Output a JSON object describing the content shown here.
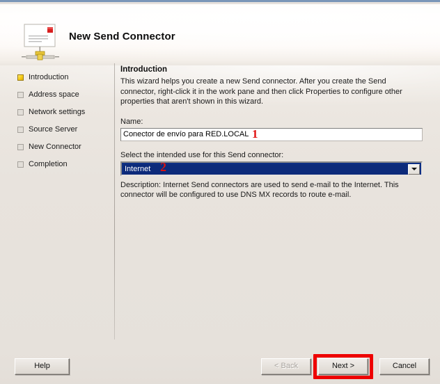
{
  "window": {
    "title": "New Send Connector",
    "icon": "send-connector-icon"
  },
  "steps": [
    {
      "label": "Introduction",
      "state": "current"
    },
    {
      "label": "Address space",
      "state": "pending"
    },
    {
      "label": "Network settings",
      "state": "pending"
    },
    {
      "label": "Source Server",
      "state": "pending"
    },
    {
      "label": "New Connector",
      "state": "pending"
    },
    {
      "label": "Completion",
      "state": "pending"
    }
  ],
  "pane": {
    "title": "Introduction",
    "intro": "This wizard helps you create a new Send connector. After you create the Send connector, right-click it in the work pane and then click Properties to configure other properties that aren't shown in this wizard.",
    "name_label": "Name:",
    "name_value": "Conector de envío para RED.LOCAL",
    "use_label": "Select the intended use for this Send connector:",
    "use_selected": "Internet",
    "description": "Description: Internet Send connectors are used to send e-mail to the Internet. This connector will be configured to use DNS MX records to route e-mail."
  },
  "annotations": {
    "one": "1",
    "two": "2",
    "color": "#e01010"
  },
  "footer": {
    "help": "Help",
    "back": "< Back",
    "next": "Next >",
    "cancel": "Cancel",
    "highlight_color": "#ee0000"
  }
}
